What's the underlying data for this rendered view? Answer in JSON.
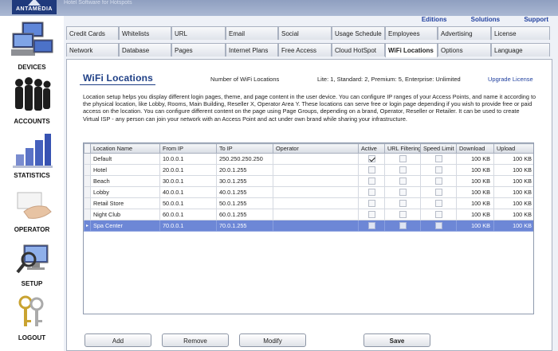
{
  "brand": {
    "logo_text": "ANTAMEDIA",
    "tagline": "Hotel Software for Hotspots"
  },
  "sidebar": {
    "items": [
      {
        "label": "DEVICES",
        "icon": "computers-icon"
      },
      {
        "label": "ACCOUNTS",
        "icon": "people-icon"
      },
      {
        "label": "STATISTICS",
        "icon": "bar-chart-icon"
      },
      {
        "label": "OPERATOR",
        "icon": "hand-card-icon"
      },
      {
        "label": "SETUP",
        "icon": "monitor-magnifier-icon"
      },
      {
        "label": "LOGOUT",
        "icon": "keys-icon"
      }
    ]
  },
  "toplinks": [
    "Editions",
    "Solutions",
    "Support"
  ],
  "tabs": {
    "row1": [
      "Credit Cards",
      "Whitelists",
      "URL",
      "Email",
      "Social",
      "Usage Schedule",
      "Employees",
      "Advertising",
      "License"
    ],
    "row2": [
      "Network",
      "Database",
      "Pages",
      "Internet Plans",
      "Free Access",
      "Cloud HotSpot",
      "WiFi Locations",
      "Options",
      "Language"
    ],
    "active": "WiFi Locations"
  },
  "panel": {
    "title": "WiFi Locations",
    "number_label": "Number of WiFi Locations",
    "license_info": "Lite: 1, Standard: 2, Premium: 5, Enterprise: Unlimited",
    "upgrade_link": "Upgrade License",
    "description": "Location setup helps you display different login pages, theme, and page content in the user device. You can configure IP ranges of your Access Points, and name it according to the physical location, like Lobby, Rooms, Main Building, Reseller X, Operator Area Y. These locations can serve free or login page depending if you wish to provide free or paid access on the location. You can configure different content on the page using Page Groups, depending on a brand, Operator, Reseller or Retailer. It can be used to create Virtual ISP - any person can join your network with an Access Point and act under own brand while sharing your infrastructure."
  },
  "table": {
    "columns": [
      "Location Name",
      "From IP",
      "To IP",
      "Operator",
      "Active",
      "URL Filtering",
      "Speed Limit",
      "Download",
      "Upload"
    ],
    "rows": [
      {
        "name": "Default",
        "from": "10.0.0.1",
        "to": "250.250.250.250",
        "operator": "",
        "active": true,
        "url_filtering": false,
        "speed_limit": false,
        "download": "100 KB",
        "upload": "100 KB"
      },
      {
        "name": "Hotel",
        "from": "20.0.0.1",
        "to": "20.0.1.255",
        "operator": "",
        "active": false,
        "url_filtering": false,
        "speed_limit": false,
        "download": "100 KB",
        "upload": "100 KB"
      },
      {
        "name": "Beach",
        "from": "30.0.0.1",
        "to": "30.0.1.255",
        "operator": "",
        "active": false,
        "url_filtering": false,
        "speed_limit": false,
        "download": "100 KB",
        "upload": "100 KB"
      },
      {
        "name": "Lobby",
        "from": "40.0.0.1",
        "to": "40.0.1.255",
        "operator": "",
        "active": false,
        "url_filtering": false,
        "speed_limit": false,
        "download": "100 KB",
        "upload": "100 KB"
      },
      {
        "name": "Retail Store",
        "from": "50.0.0.1",
        "to": "50.0.1.255",
        "operator": "",
        "active": false,
        "url_filtering": false,
        "speed_limit": false,
        "download": "100 KB",
        "upload": "100 KB"
      },
      {
        "name": "Night Club",
        "from": "60.0.0.1",
        "to": "60.0.1.255",
        "operator": "",
        "active": false,
        "url_filtering": false,
        "speed_limit": false,
        "download": "100 KB",
        "upload": "100 KB"
      },
      {
        "name": "Spa Center",
        "from": "70.0.0.1",
        "to": "70.0.1.255",
        "operator": "",
        "active": false,
        "url_filtering": false,
        "speed_limit": false,
        "download": "100 KB",
        "upload": "100 KB"
      }
    ],
    "selected_index": 6
  },
  "buttons": {
    "add": "Add",
    "remove": "Remove",
    "modify": "Modify",
    "save": "Save"
  },
  "colors": {
    "title": "#1e3f86",
    "selection": "#6d87d6",
    "link": "#1f3f9e"
  }
}
